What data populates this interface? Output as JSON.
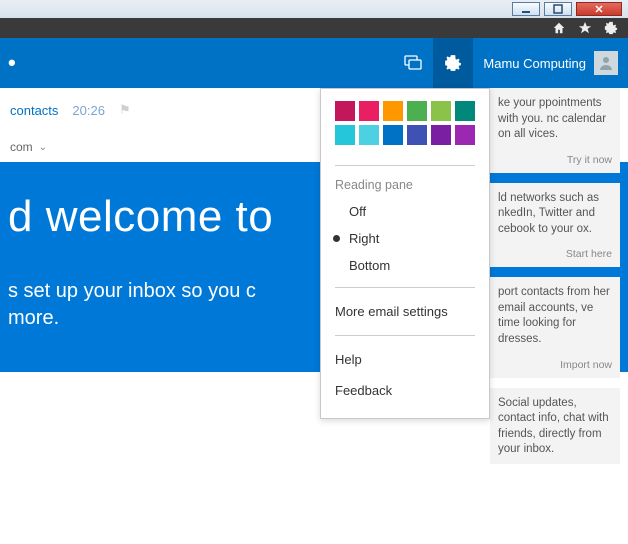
{
  "window_controls": {
    "minimize": "_",
    "maximize": "▢",
    "close": "✕"
  },
  "browser_icons": [
    "home",
    "star",
    "gear"
  ],
  "header": {
    "title_fragment": "",
    "user_name": "Mamu Computing"
  },
  "subnav": {
    "link1": "contacts",
    "time": "20:26",
    "row2_text": "com",
    "chevron": "⌄"
  },
  "hero": {
    "title": "d welcome to",
    "body_line1": "s set up your inbox so you c",
    "body_line2": "more."
  },
  "dropdown": {
    "colors": [
      "#C2185B",
      "#E91E63",
      "#FF9800",
      "#4CAF50",
      "#8BC34A",
      "#00897B",
      "#26C6DA",
      "#4DD0E1",
      "#0072C6",
      "#3F51B5",
      "#7B1FA2",
      "#9C27B0"
    ],
    "section_label": "Reading pane",
    "options": [
      {
        "label": "Off",
        "selected": false
      },
      {
        "label": "Right",
        "selected": true
      },
      {
        "label": "Bottom",
        "selected": false
      }
    ],
    "more": "More email settings",
    "help": "Help",
    "feedback": "Feedback"
  },
  "cards": [
    {
      "text": "ke your ppointments with you. nc calendar on all vices.",
      "cta": "Try it now"
    },
    {
      "text": "ld networks such as nkedIn, Twitter and cebook to your ox.",
      "cta": "Start here"
    },
    {
      "text": "port contacts from her email accounts, ve time looking for dresses.",
      "cta": "Import now"
    },
    {
      "text": "Social updates, contact info, chat with friends, directly from your inbox.",
      "cta": ""
    }
  ]
}
